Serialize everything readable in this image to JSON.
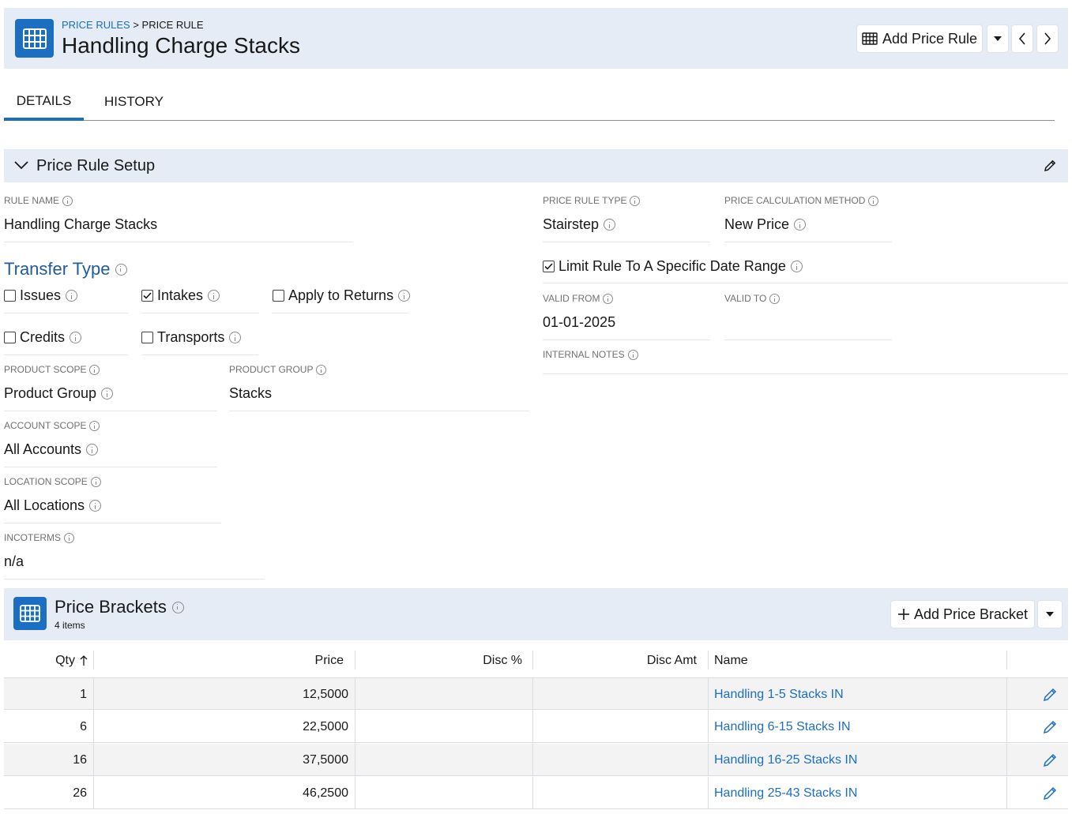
{
  "header": {
    "breadcrumb_parent": "PRICE RULES",
    "breadcrumb_sep": ">",
    "breadcrumb_current": "PRICE RULE",
    "title": "Handling Charge Stacks",
    "add_button_label": "Add Price Rule",
    "icon": "table-grid-icon"
  },
  "tabs": [
    {
      "label": "DETAILS",
      "active": true
    },
    {
      "label": "HISTORY",
      "active": false
    }
  ],
  "setup": {
    "section_title": "Price Rule Setup",
    "rule_name_label": "RULE NAME",
    "rule_name_value": "Handling Charge Stacks",
    "price_rule_type_label": "PRICE RULE TYPE",
    "price_rule_type_value": "Stairstep",
    "price_calc_label": "PRICE CALCULATION METHOD",
    "price_calc_value": "New Price",
    "transfer_type_title": "Transfer Type",
    "checkboxes": [
      {
        "label": "Issues",
        "checked": false
      },
      {
        "label": "Intakes",
        "checked": true
      },
      {
        "label": "Apply to Returns",
        "checked": false
      },
      {
        "label": "Credits",
        "checked": false
      },
      {
        "label": "Transports",
        "checked": false
      }
    ],
    "limit_date_label": "Limit Rule To A Specific Date Range",
    "limit_date_checked": true,
    "valid_from_label": "VALID FROM",
    "valid_from_value": "01-01-2025",
    "valid_to_label": "VALID TO",
    "valid_to_value": "",
    "internal_notes_label": "INTERNAL NOTES",
    "product_scope_label": "PRODUCT SCOPE",
    "product_scope_value": "Product Group",
    "product_group_label": "PRODUCT GROUP",
    "product_group_value": "Stacks",
    "account_scope_label": "ACCOUNT SCOPE",
    "account_scope_value": "All Accounts",
    "location_scope_label": "LOCATION SCOPE",
    "location_scope_value": "All Locations",
    "incoterms_label": "INCOTERMS",
    "incoterms_value": "n/a"
  },
  "brackets": {
    "title": "Price Brackets",
    "count": "4 items",
    "add_button_label": "Add Price Bracket",
    "columns": [
      "Qty",
      "Price",
      "Disc %",
      "Disc Amt",
      "Name"
    ],
    "rows": [
      {
        "qty": "1",
        "price": "12,5000",
        "disc_pct": "",
        "disc_amt": "",
        "name": "Handling 1-5 Stacks IN"
      },
      {
        "qty": "6",
        "price": "22,5000",
        "disc_pct": "",
        "disc_amt": "",
        "name": "Handling 6-15 Stacks IN"
      },
      {
        "qty": "16",
        "price": "37,5000",
        "disc_pct": "",
        "disc_amt": "",
        "name": "Handling 16-25 Stacks IN"
      },
      {
        "qty": "26",
        "price": "46,2500",
        "disc_pct": "",
        "disc_amt": "",
        "name": "Handling 25-43 Stacks IN"
      }
    ]
  }
}
